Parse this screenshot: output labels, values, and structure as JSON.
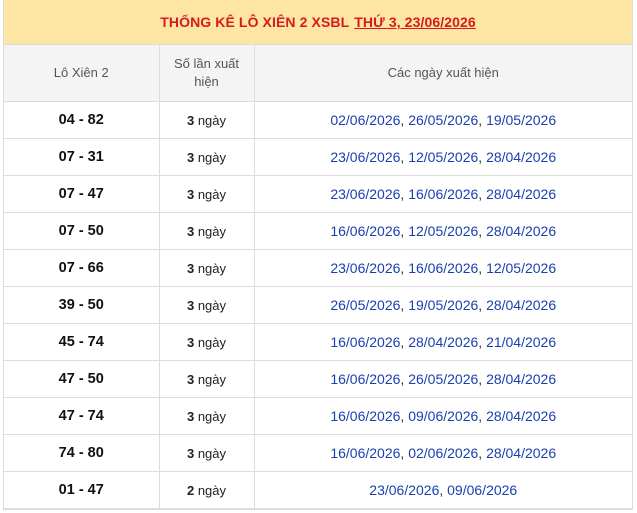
{
  "header": {
    "title": "THỐNG KÊ LÔ XIÊN 2 XSBL",
    "date_link": "THỨ 3, 23/06/2026"
  },
  "columns": {
    "pair": "Lô Xiên 2",
    "count": "Số lần xuất hiện",
    "dates": "Các ngày xuất hiện"
  },
  "rows": [
    {
      "pair": "04 - 82",
      "count": "3",
      "unit": "ngày",
      "dates": [
        "02/06/2026",
        "26/05/2026",
        "19/05/2026"
      ]
    },
    {
      "pair": "07 - 31",
      "count": "3",
      "unit": "ngày",
      "dates": [
        "23/06/2026",
        "12/05/2026",
        "28/04/2026"
      ]
    },
    {
      "pair": "07 - 47",
      "count": "3",
      "unit": "ngày",
      "dates": [
        "23/06/2026",
        "16/06/2026",
        "28/04/2026"
      ]
    },
    {
      "pair": "07 - 50",
      "count": "3",
      "unit": "ngày",
      "dates": [
        "16/06/2026",
        "12/05/2026",
        "28/04/2026"
      ]
    },
    {
      "pair": "07 - 66",
      "count": "3",
      "unit": "ngày",
      "dates": [
        "23/06/2026",
        "16/06/2026",
        "12/05/2026"
      ]
    },
    {
      "pair": "39 - 50",
      "count": "3",
      "unit": "ngày",
      "dates": [
        "26/05/2026",
        "19/05/2026",
        "28/04/2026"
      ]
    },
    {
      "pair": "45 - 74",
      "count": "3",
      "unit": "ngày",
      "dates": [
        "16/06/2026",
        "28/04/2026",
        "21/04/2026"
      ]
    },
    {
      "pair": "47 - 50",
      "count": "3",
      "unit": "ngày",
      "dates": [
        "16/06/2026",
        "26/05/2026",
        "28/04/2026"
      ]
    },
    {
      "pair": "47 - 74",
      "count": "3",
      "unit": "ngày",
      "dates": [
        "16/06/2026",
        "09/06/2026",
        "28/04/2026"
      ]
    },
    {
      "pair": "74 - 80",
      "count": "3",
      "unit": "ngày",
      "dates": [
        "16/06/2026",
        "02/06/2026",
        "28/04/2026"
      ]
    },
    {
      "pair": "01 - 47",
      "count": "2",
      "unit": "ngày",
      "dates": [
        "23/06/2026",
        "09/06/2026"
      ]
    }
  ],
  "colors": {
    "title": "#d71920",
    "title_bg": "#fde6a3",
    "date_link": "#1a3fb0"
  }
}
